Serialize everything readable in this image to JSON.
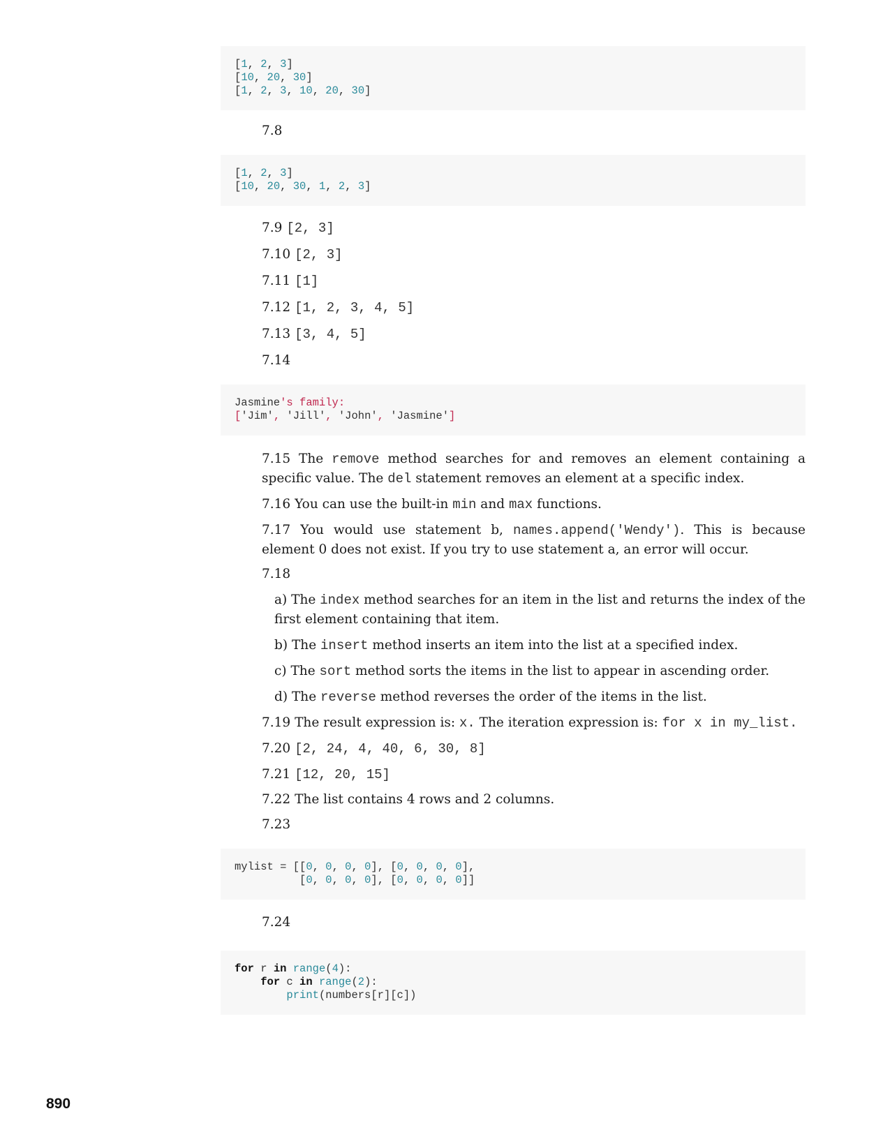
{
  "code_blocks": {
    "cb1": {
      "lines": [
        "[1, 2, 3]",
        "[10, 20, 30]",
        "[1, 2, 3, 10, 20, 30]"
      ]
    },
    "cb2": {
      "lines": [
        "[1, 2, 3]",
        "[10, 20, 30, 1, 2, 3]"
      ]
    },
    "cb3": {
      "line1_plain": "Jasmine",
      "line1_str": "'s family:",
      "line2_str": "['Jim', 'Jill', 'John', 'Jasmine']"
    },
    "cb4": {
      "lines": [
        "mylist = [[0, 0, 0, 0], [0, 0, 0, 0],",
        "          [0, 0, 0, 0], [0, 0, 0, 0]]"
      ]
    },
    "cb5": {
      "lines": [
        "for r in range(4):",
        "    for c in range(2):",
        "        print(numbers[r][c])"
      ]
    }
  },
  "answers": {
    "a7_8": "7.8",
    "a7_9": {
      "num": "7.9",
      "code": "[2, 3]"
    },
    "a7_10": {
      "num": "7.10",
      "code": "[2, 3]"
    },
    "a7_11": {
      "num": "7.11",
      "code": "[1]"
    },
    "a7_12": {
      "num": "7.12",
      "code": "[1, 2, 3, 4, 5]"
    },
    "a7_13": {
      "num": "7.13",
      "code": "[3, 4, 5]"
    },
    "a7_14": "7.14",
    "a7_15": {
      "t1": "7.15 The ",
      "c1": "remove",
      "t2": " method searches for and removes an element containing a specific value. The ",
      "c2": "del",
      "t3": " statement removes an element at a specific index."
    },
    "a7_16": {
      "t1": "7.16 You can use the built-in ",
      "c1": "min",
      "t2": " and ",
      "c2": "max",
      "t3": " functions."
    },
    "a7_17": {
      "t1": "7.17 You would use statement b, ",
      "c1": "names.append('Wendy')",
      "t2": ". This is because element 0 does not exist. If you try to use statement a, an error will occur."
    },
    "a7_18": "7.18",
    "a7_18a": {
      "t1": "a) The ",
      "c1": "index",
      "t2": " method searches for an item in the list and returns the index of the first element containing that item."
    },
    "a7_18b": {
      "t1": "b) The ",
      "c1": "insert",
      "t2": " method inserts an item into the list at a specified index."
    },
    "a7_18c": {
      "t1": "c) The ",
      "c1": "sort",
      "t2": " method sorts the items in the list to appear in ascending order."
    },
    "a7_18d": {
      "t1": "d) The ",
      "c1": "reverse",
      "t2": " method reverses the order of the items in the list."
    },
    "a7_19": {
      "t1": "7.19 The result expression is: ",
      "c1": "x.",
      "t2": " The iteration expression is: ",
      "c2": "for x in my_list."
    },
    "a7_20": {
      "num": "7.20",
      "code": "[2, 24, 4, 40, 6, 30, 8]"
    },
    "a7_21": {
      "num": "7.21",
      "code": "[12, 20, 15]"
    },
    "a7_22": "7.22 The list contains 4 rows and 2 columns.",
    "a7_23": "7.23",
    "a7_24": "7.24"
  },
  "page_number": "890"
}
